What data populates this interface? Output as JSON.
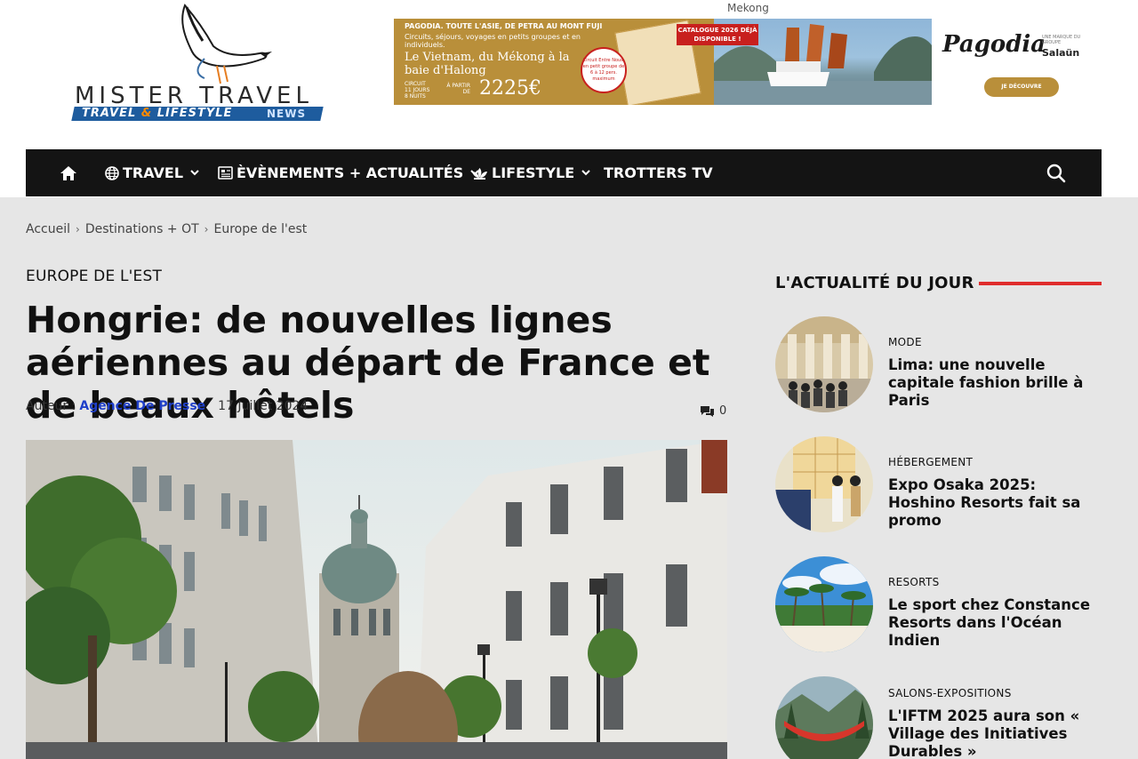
{
  "header": {
    "logo_main": "MISTER TRAVEL",
    "logo_sub_a": "TRAVEL",
    "logo_sub_amp": "&",
    "logo_sub_b": "LIFESTYLE",
    "logo_news": "NEWS",
    "ad_caption": "Mekong",
    "ad": {
      "headline": "PAGODIA. TOUTE L'ASIE, DE PETRA AU MONT FUJI",
      "subline": "Circuits, séjours, voyages en petits groupes et en individuels.",
      "title": "Le Vietnam, du Mékong à la baie d'Halong",
      "circuit_label": "CIRCUIT 11 JOURS 8 NUITS",
      "price_label": "À PARTIR DE",
      "price": "2225€",
      "circle_text": "Circuit Entre Nous, en petit groupe de 6 à 12 pers. maximum",
      "catalog_tag": "CATALOGUE 2026 DÉJÀ DISPONIBLE !",
      "brand": "Pagodia",
      "brand_sub": "UNE MARQUE DU GROUPE",
      "brand_group": "Salaün",
      "cta": "JE DÉCOUVRE"
    }
  },
  "nav": {
    "items": [
      {
        "label": "TRAVEL"
      },
      {
        "label": "ÈVÈNEMENTS + ACTUALITÉS"
      },
      {
        "label": "LIFESTYLE"
      },
      {
        "label": "TROTTERS TV"
      }
    ]
  },
  "breadcrumb": [
    "Accueil",
    "Destinations + OT",
    "Europe de l'est"
  ],
  "article": {
    "category": "EUROPE DE L'EST",
    "title": "Hongrie: de nouvelles lignes aériennes au départ de France et de beaux hôtels",
    "author_label": "Auteur :",
    "author": "Agence De Presse",
    "date": "17 Juillet 2024",
    "comments": "0"
  },
  "sidebar": {
    "heading": "L'ACTUALITÉ DU JOUR",
    "accent_color": "#e02d2d",
    "items": [
      {
        "category": "MODE",
        "title": "Lima: une nouvelle capitale fashion brille à Paris"
      },
      {
        "category": "HÉBERGEMENT",
        "title": "Expo Osaka 2025: Hoshino Resorts fait sa promo"
      },
      {
        "category": "RESORTS",
        "title": "Le sport chez Constance Resorts dans l'Océan Indien"
      },
      {
        "category": "SALONS-EXPOSITIONS",
        "title": "L'IFTM 2025 aura son « Village des Initiatives Durables »"
      }
    ]
  }
}
